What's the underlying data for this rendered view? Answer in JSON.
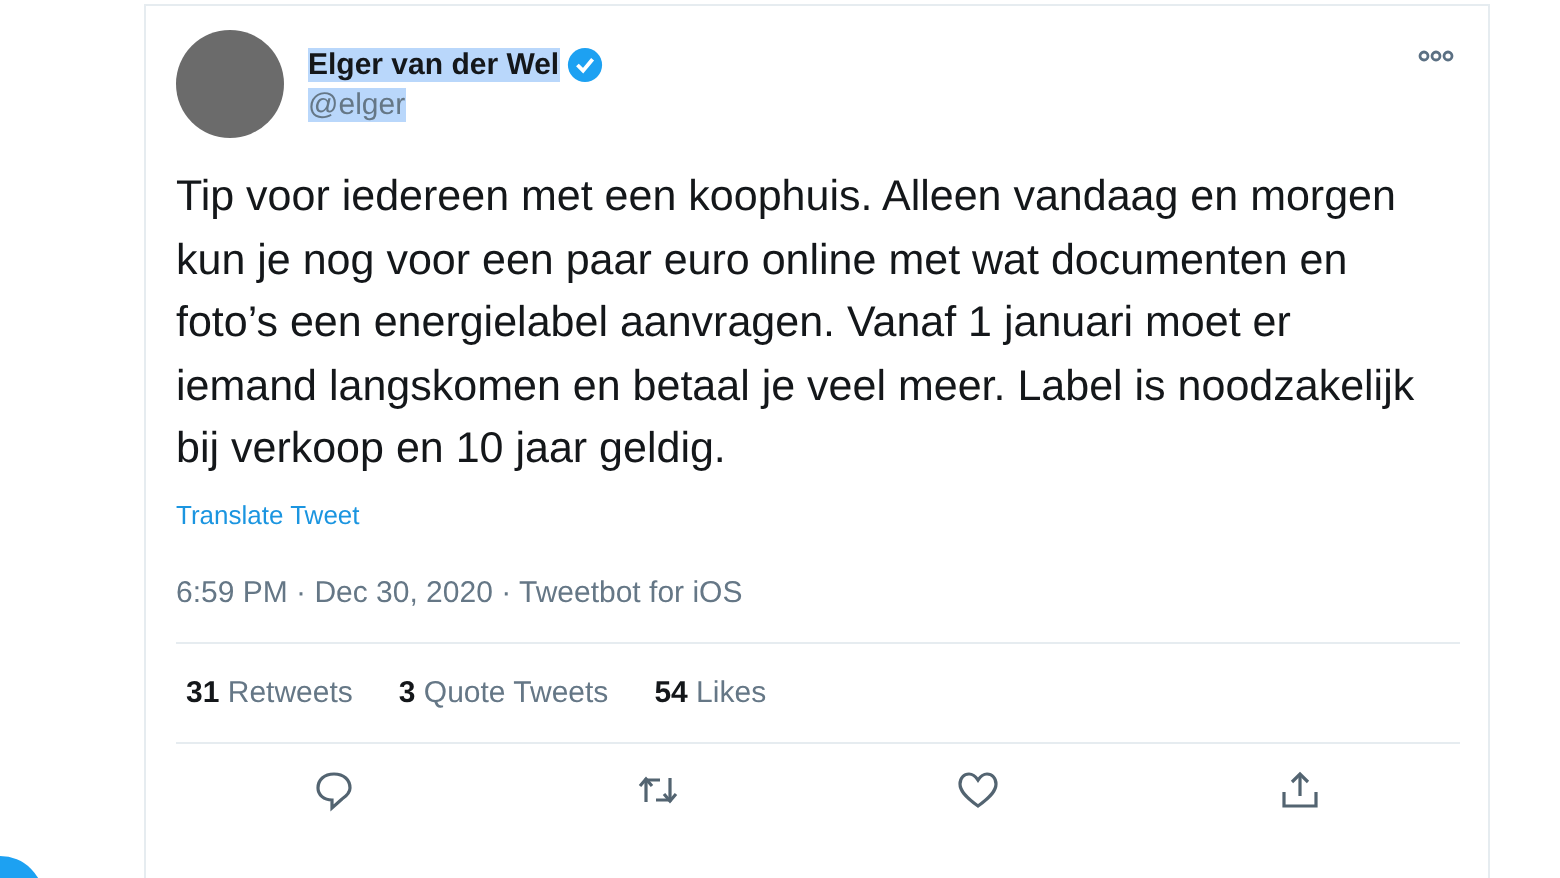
{
  "tweet": {
    "author": {
      "name": "Elger van der Wel",
      "handle": "@elger",
      "verified": true,
      "highlighted": true
    },
    "text": "Tip voor iedereen met een koophuis. Alleen vandaag en morgen kun je nog voor een paar euro online met wat documenten en foto’s een energielabel aanvragen. Vanaf 1 januari moet er iemand langskomen en betaal je veel meer. Label is noodzakelijk bij verkoop en 10 jaar geldig.",
    "translate_link": "Translate Tweet",
    "meta": "6:59 PM · Dec 30, 2020 · Tweetbot for iOS",
    "stats": [
      {
        "count": "31",
        "label": "Retweets"
      },
      {
        "count": "3",
        "label": "Quote Tweets"
      },
      {
        "count": "54",
        "label": "Likes"
      }
    ],
    "actions": [
      {
        "kind": "reply"
      },
      {
        "kind": "retweet"
      },
      {
        "kind": "like"
      },
      {
        "kind": "share"
      }
    ]
  }
}
